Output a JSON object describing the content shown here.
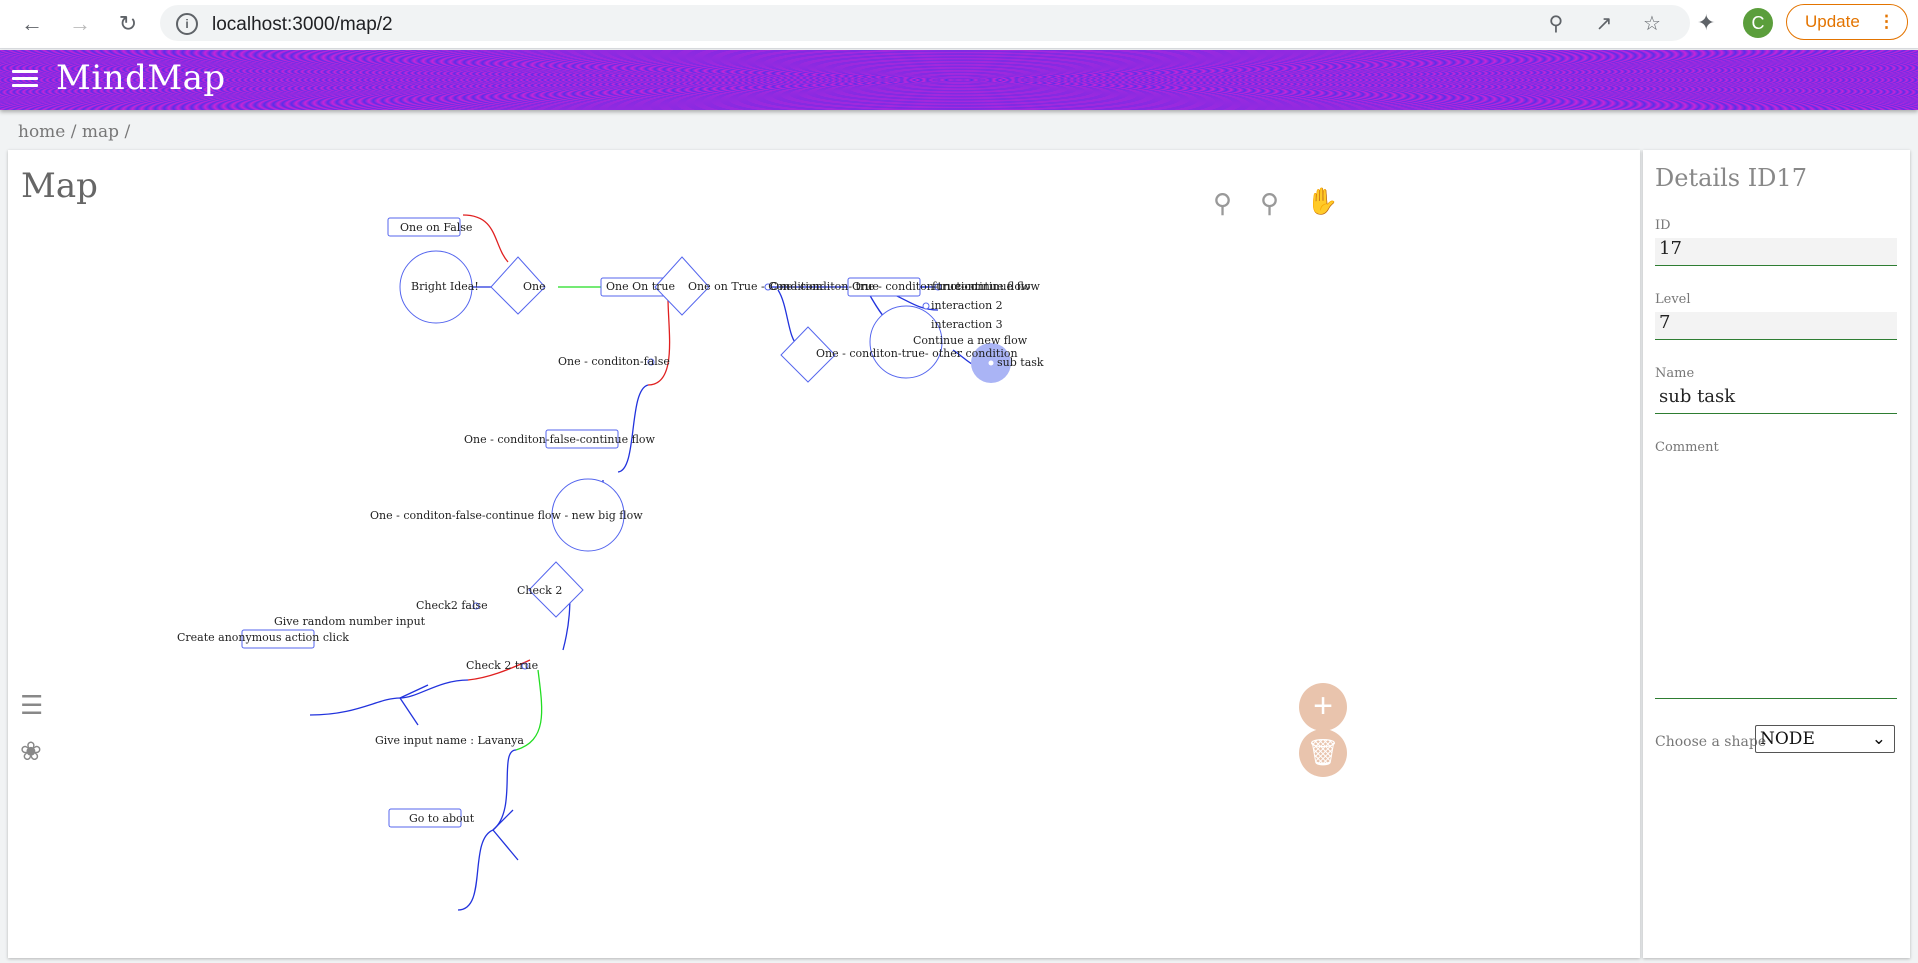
{
  "browser": {
    "url": "localhost:3000/map/2",
    "update_label": "Update",
    "avatar_letter": "C"
  },
  "app": {
    "title": "MindMap"
  },
  "breadcrumb": "home / map /",
  "map": {
    "title": "Map",
    "nodes": {
      "bright_idea": "Bright Idea!",
      "one_on_false": "One on False",
      "one": "One",
      "one_on_true": "One On true",
      "one_on_true_condition": "One on True - Condition",
      "one_condition_true": "One- conditon- true",
      "one_condition_true_continue": "One - conditon-true-continue flow",
      "function": "function",
      "continue_flow": "continue flow",
      "interaction2": "interaction 2",
      "interaction3": "interaction 3",
      "continue_new_flow": "Continue a new flow",
      "other_condition": "One - conditon-true- other condition",
      "sub_task": "sub task",
      "condition_false": "One - conditon-false",
      "condition_false_continue": "One - conditon-false-continue flow",
      "big_flow": "One - conditon-false-continue flow - new big flow",
      "check2": "Check 2",
      "check2_false": "Check2 false",
      "random_input": "Give random number input",
      "anonymous_click": "Create anonymous action click",
      "check2_true": "Check 2 true",
      "input_name": "Give input name : Lavanya",
      "go_about": "Go to about"
    }
  },
  "details": {
    "title": "Details ID17",
    "id_label": "ID",
    "id_value": "17",
    "level_label": "Level",
    "level_value": "7",
    "name_label": "Name",
    "name_value": "sub task",
    "comment_label": "Comment",
    "comment_value": "",
    "shape_label": "Choose a shape",
    "shape_value": "NODE"
  },
  "colors": {
    "link": "#2233dd",
    "false_link": "#e02020",
    "true_link": "#22dd22",
    "selected": "#aab4f5",
    "fab": "#e9c4ad"
  }
}
